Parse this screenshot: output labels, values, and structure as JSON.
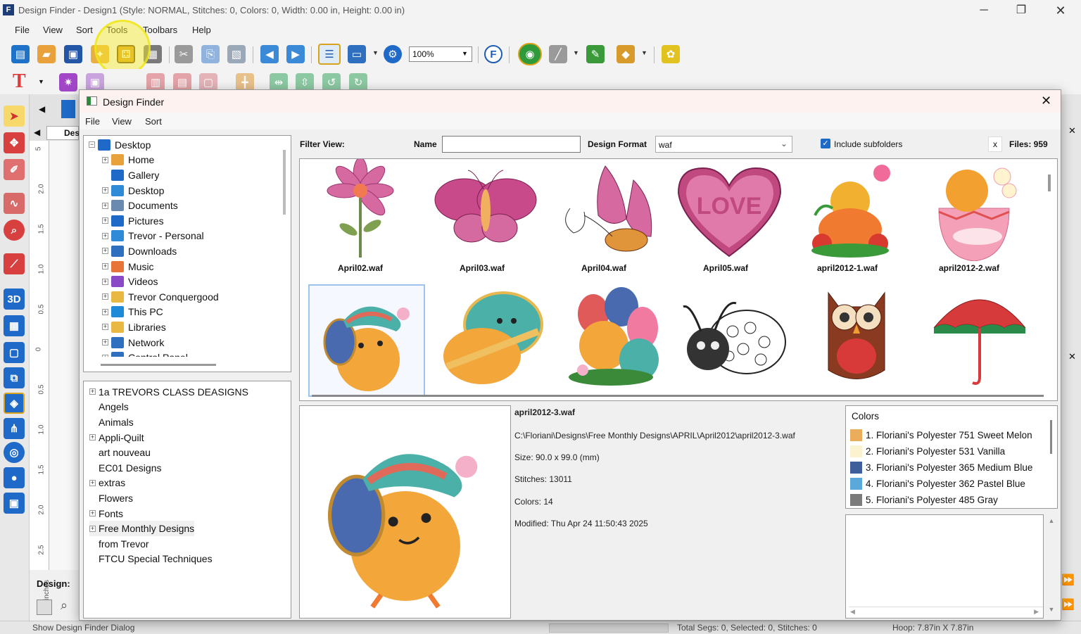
{
  "app": {
    "title": "Design Finder - Design1 (Style: NORMAL, Stitches: 0, Colors: 0, Width: 0.00 in, Height: 0.00 in)",
    "menu": [
      "File",
      "View",
      "Sort",
      "Tools",
      "Toolbars",
      "Help"
    ],
    "zoom": "100%",
    "design_label": "Design:",
    "canvas_tab": "Des"
  },
  "ruler": [
    "5",
    "2.0",
    "1.5",
    "1.0",
    "0.5",
    "0",
    "0.5",
    "1.0",
    "1.5",
    "2.0",
    "2.5",
    "inches"
  ],
  "status": {
    "hint": "Show Design Finder Dialog",
    "segs": "Total Segs: 0, Selected: 0, Stitches: 0",
    "hoop": "Hoop: 7.87in X 7.87in"
  },
  "dialog": {
    "title": "Design Finder",
    "menu": [
      "File",
      "View",
      "Sort"
    ],
    "filter_view": "Filter View:",
    "name_label": "Name",
    "name_value": "",
    "format_label": "Design Format",
    "format_value": "waf",
    "include_subfolders": "Include subfolders",
    "clear": "x",
    "files": "Files: 959",
    "tree": [
      {
        "label": "Desktop",
        "level": 0,
        "exp": "−"
      },
      {
        "label": "Home",
        "level": 1,
        "exp": "+"
      },
      {
        "label": "Gallery",
        "level": 1,
        "exp": ""
      },
      {
        "label": "Desktop",
        "level": 1,
        "exp": "+"
      },
      {
        "label": "Documents",
        "level": 1,
        "exp": "+"
      },
      {
        "label": "Pictures",
        "level": 1,
        "exp": "+"
      },
      {
        "label": "Trevor - Personal",
        "level": 1,
        "exp": "+"
      },
      {
        "label": "Downloads",
        "level": 1,
        "exp": "+"
      },
      {
        "label": "Music",
        "level": 1,
        "exp": "+"
      },
      {
        "label": "Videos",
        "level": 1,
        "exp": "+"
      },
      {
        "label": "Trevor Conquergood",
        "level": 1,
        "exp": "+"
      },
      {
        "label": "This PC",
        "level": 1,
        "exp": "+"
      },
      {
        "label": "Libraries",
        "level": 1,
        "exp": "+"
      },
      {
        "label": "Network",
        "level": 1,
        "exp": "+"
      },
      {
        "label": "Control Panel",
        "level": 1,
        "exp": "+"
      }
    ],
    "folders": [
      {
        "label": "1a TREVORS CLASS DEASIGNS",
        "exp": "+"
      },
      {
        "label": "Angels",
        "exp": ""
      },
      {
        "label": "Animals",
        "exp": ""
      },
      {
        "label": "Appli-Quilt",
        "exp": "+"
      },
      {
        "label": "art nouveau",
        "exp": ""
      },
      {
        "label": "EC01 Designs",
        "exp": ""
      },
      {
        "label": "extras",
        "exp": "+"
      },
      {
        "label": "Flowers",
        "exp": ""
      },
      {
        "label": "Fonts",
        "exp": "+"
      },
      {
        "label": "Free Monthly Designs",
        "exp": "+"
      },
      {
        "label": "from Trevor",
        "exp": ""
      },
      {
        "label": "FTCU Special Techniques",
        "exp": ""
      }
    ],
    "thumbs_row1": [
      "April02.waf",
      "April03.waf",
      "April04.waf",
      "April05.waf",
      "april2012-1.waf",
      "april2012-2.waf"
    ],
    "selected": {
      "name": "april2012-3.waf",
      "path": "C:\\Floriani\\Designs\\Free Monthly Designs\\APRIL\\April2012\\april2012-3.waf",
      "size": "Size: 90.0 x 99.0 (mm)",
      "stitches": "Stitches: 13011",
      "colors": "Colors: 14",
      "modified": "Modified: Thu Apr 24 11:50:43 2025"
    },
    "colors_title": "Colors",
    "colors": [
      {
        "label": "1. Floriani's Polyester 751 Sweet Melon",
        "hex": "#e9ad5c"
      },
      {
        "label": "2. Floriani's Polyester 531 Vanilla",
        "hex": "#fbf2cf"
      },
      {
        "label": "3. Floriani's Polyester 365 Medium Blue",
        "hex": "#3f5f9a"
      },
      {
        "label": "4. Floriani's Polyester 362 Pastel Blue",
        "hex": "#5ba9da"
      },
      {
        "label": "5. Floriani's Polyester 485 Gray",
        "hex": "#7b7b7b"
      }
    ]
  }
}
